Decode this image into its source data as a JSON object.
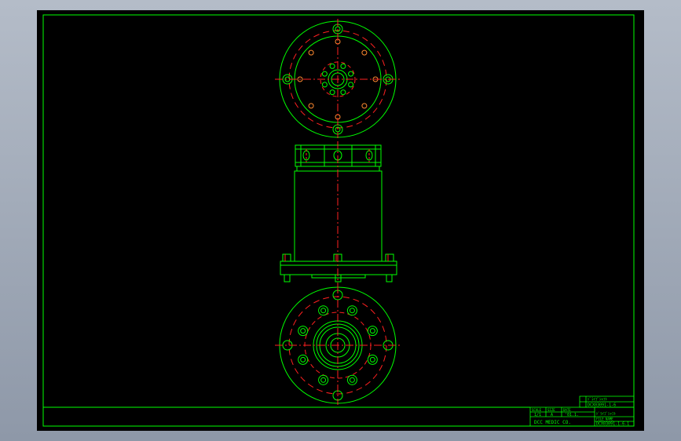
{
  "title_block": {
    "upper_row1": "ﾄﾞﾗｲﾌﾞｼｬﾌﾄ",
    "upper_row2": "DCX03091-1-6",
    "label1": "SCALE",
    "label2": "SIZE",
    "label3": "DATE",
    "value1": "1/1",
    "value2": "A",
    "value3": "'01.1.",
    "company": "DCC MEDIC CO.",
    "part_name": "ﾄﾞﾗｲﾌﾞｼｬﾌﾄ",
    "file_label": "FILE NAME",
    "file_name": "DCX03091-1-6-1"
  },
  "colors": {
    "outline": "#00ff00",
    "center_line": "#ff2020",
    "sheet": "#000000",
    "background": "#a0a8b6"
  }
}
